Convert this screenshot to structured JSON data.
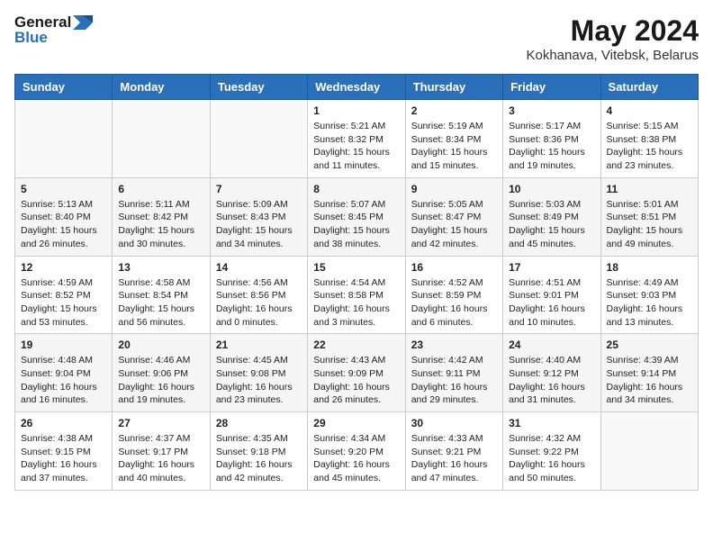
{
  "header": {
    "logo_line1": "General",
    "logo_line2": "Blue",
    "month_year": "May 2024",
    "location": "Kokhanava, Vitebsk, Belarus"
  },
  "weekdays": [
    "Sunday",
    "Monday",
    "Tuesday",
    "Wednesday",
    "Thursday",
    "Friday",
    "Saturday"
  ],
  "weeks": [
    [
      {
        "day": "",
        "sunrise": "",
        "sunset": "",
        "daylight": ""
      },
      {
        "day": "",
        "sunrise": "",
        "sunset": "",
        "daylight": ""
      },
      {
        "day": "",
        "sunrise": "",
        "sunset": "",
        "daylight": ""
      },
      {
        "day": "1",
        "sunrise": "Sunrise: 5:21 AM",
        "sunset": "Sunset: 8:32 PM",
        "daylight": "Daylight: 15 hours and 11 minutes."
      },
      {
        "day": "2",
        "sunrise": "Sunrise: 5:19 AM",
        "sunset": "Sunset: 8:34 PM",
        "daylight": "Daylight: 15 hours and 15 minutes."
      },
      {
        "day": "3",
        "sunrise": "Sunrise: 5:17 AM",
        "sunset": "Sunset: 8:36 PM",
        "daylight": "Daylight: 15 hours and 19 minutes."
      },
      {
        "day": "4",
        "sunrise": "Sunrise: 5:15 AM",
        "sunset": "Sunset: 8:38 PM",
        "daylight": "Daylight: 15 hours and 23 minutes."
      }
    ],
    [
      {
        "day": "5",
        "sunrise": "Sunrise: 5:13 AM",
        "sunset": "Sunset: 8:40 PM",
        "daylight": "Daylight: 15 hours and 26 minutes."
      },
      {
        "day": "6",
        "sunrise": "Sunrise: 5:11 AM",
        "sunset": "Sunset: 8:42 PM",
        "daylight": "Daylight: 15 hours and 30 minutes."
      },
      {
        "day": "7",
        "sunrise": "Sunrise: 5:09 AM",
        "sunset": "Sunset: 8:43 PM",
        "daylight": "Daylight: 15 hours and 34 minutes."
      },
      {
        "day": "8",
        "sunrise": "Sunrise: 5:07 AM",
        "sunset": "Sunset: 8:45 PM",
        "daylight": "Daylight: 15 hours and 38 minutes."
      },
      {
        "day": "9",
        "sunrise": "Sunrise: 5:05 AM",
        "sunset": "Sunset: 8:47 PM",
        "daylight": "Daylight: 15 hours and 42 minutes."
      },
      {
        "day": "10",
        "sunrise": "Sunrise: 5:03 AM",
        "sunset": "Sunset: 8:49 PM",
        "daylight": "Daylight: 15 hours and 45 minutes."
      },
      {
        "day": "11",
        "sunrise": "Sunrise: 5:01 AM",
        "sunset": "Sunset: 8:51 PM",
        "daylight": "Daylight: 15 hours and 49 minutes."
      }
    ],
    [
      {
        "day": "12",
        "sunrise": "Sunrise: 4:59 AM",
        "sunset": "Sunset: 8:52 PM",
        "daylight": "Daylight: 15 hours and 53 minutes."
      },
      {
        "day": "13",
        "sunrise": "Sunrise: 4:58 AM",
        "sunset": "Sunset: 8:54 PM",
        "daylight": "Daylight: 15 hours and 56 minutes."
      },
      {
        "day": "14",
        "sunrise": "Sunrise: 4:56 AM",
        "sunset": "Sunset: 8:56 PM",
        "daylight": "Daylight: 16 hours and 0 minutes."
      },
      {
        "day": "15",
        "sunrise": "Sunrise: 4:54 AM",
        "sunset": "Sunset: 8:58 PM",
        "daylight": "Daylight: 16 hours and 3 minutes."
      },
      {
        "day": "16",
        "sunrise": "Sunrise: 4:52 AM",
        "sunset": "Sunset: 8:59 PM",
        "daylight": "Daylight: 16 hours and 6 minutes."
      },
      {
        "day": "17",
        "sunrise": "Sunrise: 4:51 AM",
        "sunset": "Sunset: 9:01 PM",
        "daylight": "Daylight: 16 hours and 10 minutes."
      },
      {
        "day": "18",
        "sunrise": "Sunrise: 4:49 AM",
        "sunset": "Sunset: 9:03 PM",
        "daylight": "Daylight: 16 hours and 13 minutes."
      }
    ],
    [
      {
        "day": "19",
        "sunrise": "Sunrise: 4:48 AM",
        "sunset": "Sunset: 9:04 PM",
        "daylight": "Daylight: 16 hours and 16 minutes."
      },
      {
        "day": "20",
        "sunrise": "Sunrise: 4:46 AM",
        "sunset": "Sunset: 9:06 PM",
        "daylight": "Daylight: 16 hours and 19 minutes."
      },
      {
        "day": "21",
        "sunrise": "Sunrise: 4:45 AM",
        "sunset": "Sunset: 9:08 PM",
        "daylight": "Daylight: 16 hours and 23 minutes."
      },
      {
        "day": "22",
        "sunrise": "Sunrise: 4:43 AM",
        "sunset": "Sunset: 9:09 PM",
        "daylight": "Daylight: 16 hours and 26 minutes."
      },
      {
        "day": "23",
        "sunrise": "Sunrise: 4:42 AM",
        "sunset": "Sunset: 9:11 PM",
        "daylight": "Daylight: 16 hours and 29 minutes."
      },
      {
        "day": "24",
        "sunrise": "Sunrise: 4:40 AM",
        "sunset": "Sunset: 9:12 PM",
        "daylight": "Daylight: 16 hours and 31 minutes."
      },
      {
        "day": "25",
        "sunrise": "Sunrise: 4:39 AM",
        "sunset": "Sunset: 9:14 PM",
        "daylight": "Daylight: 16 hours and 34 minutes."
      }
    ],
    [
      {
        "day": "26",
        "sunrise": "Sunrise: 4:38 AM",
        "sunset": "Sunset: 9:15 PM",
        "daylight": "Daylight: 16 hours and 37 minutes."
      },
      {
        "day": "27",
        "sunrise": "Sunrise: 4:37 AM",
        "sunset": "Sunset: 9:17 PM",
        "daylight": "Daylight: 16 hours and 40 minutes."
      },
      {
        "day": "28",
        "sunrise": "Sunrise: 4:35 AM",
        "sunset": "Sunset: 9:18 PM",
        "daylight": "Daylight: 16 hours and 42 minutes."
      },
      {
        "day": "29",
        "sunrise": "Sunrise: 4:34 AM",
        "sunset": "Sunset: 9:20 PM",
        "daylight": "Daylight: 16 hours and 45 minutes."
      },
      {
        "day": "30",
        "sunrise": "Sunrise: 4:33 AM",
        "sunset": "Sunset: 9:21 PM",
        "daylight": "Daylight: 16 hours and 47 minutes."
      },
      {
        "day": "31",
        "sunrise": "Sunrise: 4:32 AM",
        "sunset": "Sunset: 9:22 PM",
        "daylight": "Daylight: 16 hours and 50 minutes."
      },
      {
        "day": "",
        "sunrise": "",
        "sunset": "",
        "daylight": ""
      }
    ]
  ]
}
